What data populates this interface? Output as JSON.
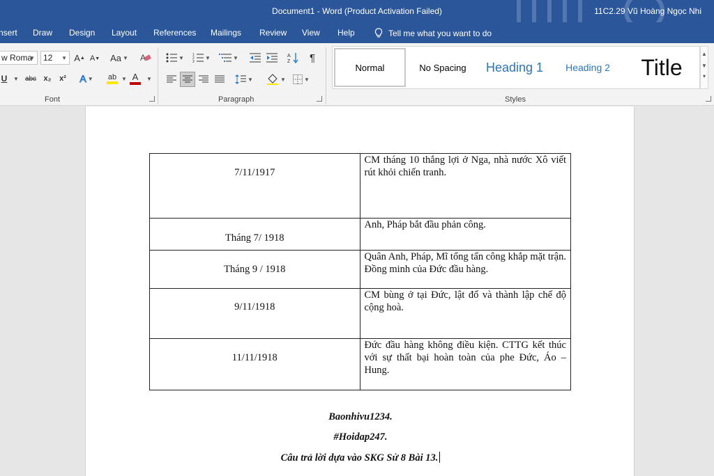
{
  "titlebar": {
    "title": "Document1  -  Word (Product Activation Failed)",
    "user": "11C2.29 Vũ Hoàng Ngọc Nhi"
  },
  "menu": {
    "tabs": [
      "nsert",
      "Draw",
      "Design",
      "Layout",
      "References",
      "Mailings",
      "Review",
      "View",
      "Help"
    ],
    "tell_me": "Tell me what you want to do"
  },
  "ribbon": {
    "font": {
      "font_name": "w Roma",
      "font_size": "12",
      "group_label": "Font",
      "grow": "A",
      "shrink": "A",
      "change_case": "Aa",
      "underline": "U",
      "strike": "abc",
      "subscript": "x₂",
      "superscript": "x²",
      "text_effects": "A",
      "highlight": "ab",
      "font_color": "A"
    },
    "paragraph": {
      "group_label": "Paragraph",
      "pilcrow": "¶"
    },
    "styles": {
      "group_label": "Styles",
      "items": [
        "Normal",
        "No Spacing",
        "Heading 1",
        "Heading 2",
        "Title"
      ]
    }
  },
  "colors": {
    "titlebar": "#2b579a",
    "heading_blue": "#2e74b5",
    "highlight": "#ffe600",
    "font_color": "#c00000"
  },
  "document": {
    "rows": [
      {
        "date": "7/11/1917",
        "event": "CM tháng 10  thắng lợi ở Nga, nhà nước Xô viết rút khỏi chiến tranh."
      },
      {
        "date": "Tháng 7/ 1918",
        "event": "Anh, Pháp bắt đầu phản công."
      },
      {
        "date": "Tháng 9 / 1918",
        "event": "Quân Anh, Pháp, Mĩ tổng tấn công khắp mặt trận. Đồng minh của Đức đầu hàng."
      },
      {
        "date": "9/11/1918",
        "event": "CM bùng ở tại Đức, lật đổ và thành lập chế độ cộng hoà."
      },
      {
        "date": "11/11/1918",
        "event": "Đức đầu hàng không điều kiện. CTTG kết thúc với sự thất bại hoàn toàn của phe Đức, Áo – Hung."
      }
    ],
    "notes": {
      "line1": "Baonhivu1234.",
      "line2": "#Hoidap247.",
      "line3": "Câu trả lời dựa vào SKG Sử 8 Bài 13."
    }
  }
}
